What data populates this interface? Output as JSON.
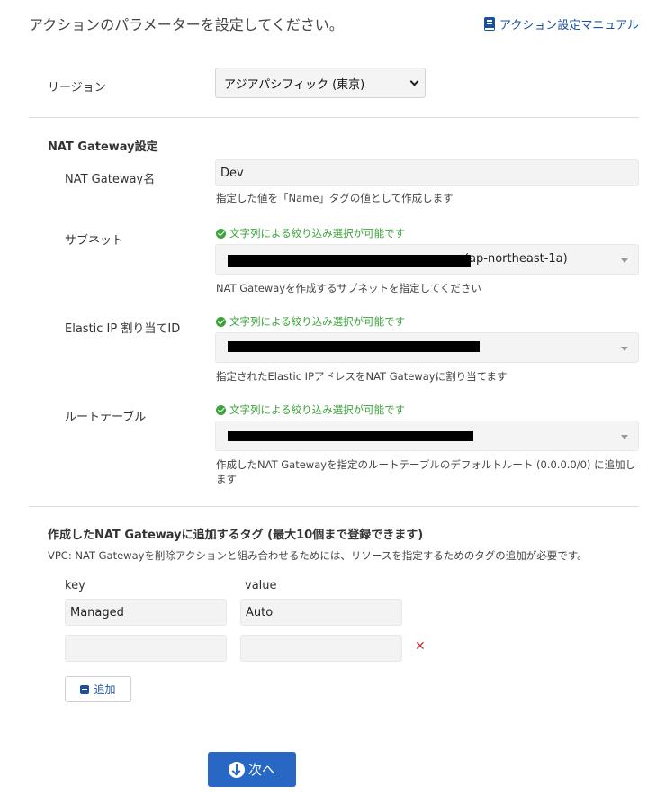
{
  "header": {
    "title": "アクションのパラメーターを設定してください。",
    "manual_link": "アクション設定マニュアル"
  },
  "region": {
    "label": "リージョン",
    "selected": "アジアパシフィック (東京)"
  },
  "nat_gateway": {
    "section_title": "NAT Gateway設定",
    "name": {
      "label": "NAT Gateway名",
      "value": "Dev",
      "help": "指定した値を「Name」タグの値として作成します"
    },
    "subnet": {
      "label": "サブネット",
      "filter_note": "文字列による絞り込み選択が可能です",
      "value_visible": "(ap-northeast-1a)",
      "help": "NAT Gatewayを作成するサブネットを指定してください"
    },
    "eip": {
      "label": "Elastic IP 割り当てID",
      "filter_note": "文字列による絞り込み選択が可能です",
      "help": "指定されたElastic IPアドレスをNAT Gatewayに割り当てます"
    },
    "route_table": {
      "label": "ルートテーブル",
      "filter_note": "文字列による絞り込み選択が可能です",
      "help_line1": "作成したNAT Gatewayを指定のルートテーブルのデフォルトルート (0.0.0.0/0) に追加し",
      "help_line2": "ます"
    }
  },
  "tags": {
    "section_title": "作成したNAT Gatewayに追加するタグ (最大10個まで登録できます)",
    "note": "VPC: NAT Gatewayを削除アクションと組み合わせるためには、リソースを指定するためのタグの追加が必要です。",
    "key_header": "key",
    "value_header": "value",
    "rows": [
      {
        "key": "Managed",
        "value": "Auto"
      },
      {
        "key": "",
        "value": ""
      }
    ],
    "remove_symbol": "✕",
    "add_label": "追加"
  },
  "footer": {
    "next_label": "次へ"
  },
  "colors": {
    "accent": "#2868c4",
    "link": "#1a4fa0",
    "success": "#3aa33a",
    "danger": "#d23030"
  }
}
